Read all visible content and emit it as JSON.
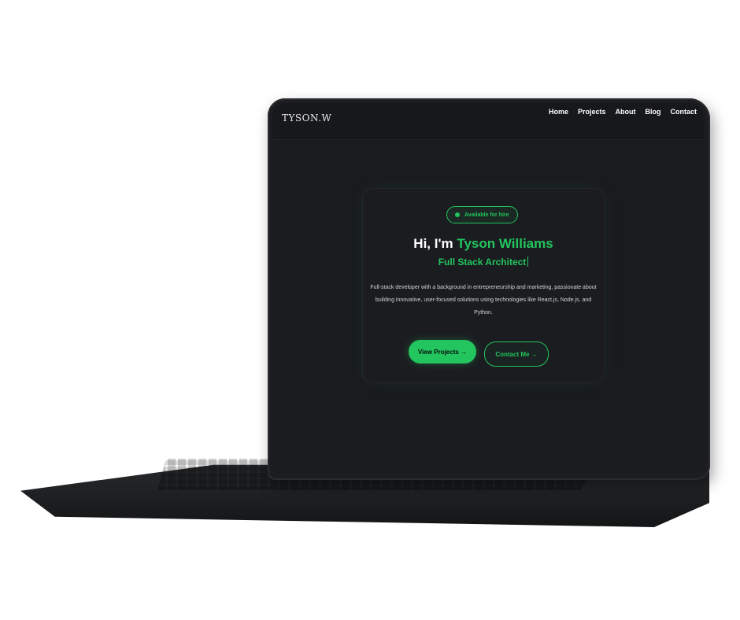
{
  "brand": {
    "logo_text": "TYSON.W"
  },
  "nav": {
    "items": [
      "Home",
      "Projects",
      "About",
      "Blog",
      "Contact"
    ]
  },
  "hero": {
    "badge": "Available for hire",
    "greeting": "Hi, I'm",
    "name": "Tyson Williams",
    "role": "Full Stack  Architect",
    "description": "Full-stack developer with a background in entrepreneurship and marketing, passionate about building innovative, user-focused solutions using technologies like React.js, Node.js, and Python.",
    "primary_button": "View Projects →",
    "secondary_button": "Contact Me →"
  },
  "colors": {
    "accent": "#22c55e",
    "background": "#1a1b1f",
    "card": "#1b1c20",
    "text": "#ffffff"
  }
}
